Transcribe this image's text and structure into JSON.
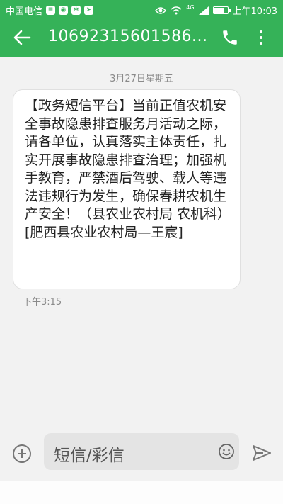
{
  "status_bar": {
    "carrier": "中国电信",
    "signal_type": "4G",
    "time": "上午10:03"
  },
  "header": {
    "title": "10692315601586..."
  },
  "conversation": {
    "date": "3月27日星期五",
    "message_text": "【政务短信平台】当前正值农机安全事故隐患排查服务月活动之际，请各单位，认真落实主体责任，扎实开展事故隐患排查治理；加强机手教育，严禁酒后驾驶、载人等违法违规行为发生，确保春耕农机生产安全！（县农业农村局 农机科）[肥西县农业农村局—王宸]",
    "message_time": "下午3:15"
  },
  "composer": {
    "placeholder": "短信/彩信"
  },
  "colors": {
    "accent": "#35b258",
    "background": "#f2f2f2"
  }
}
